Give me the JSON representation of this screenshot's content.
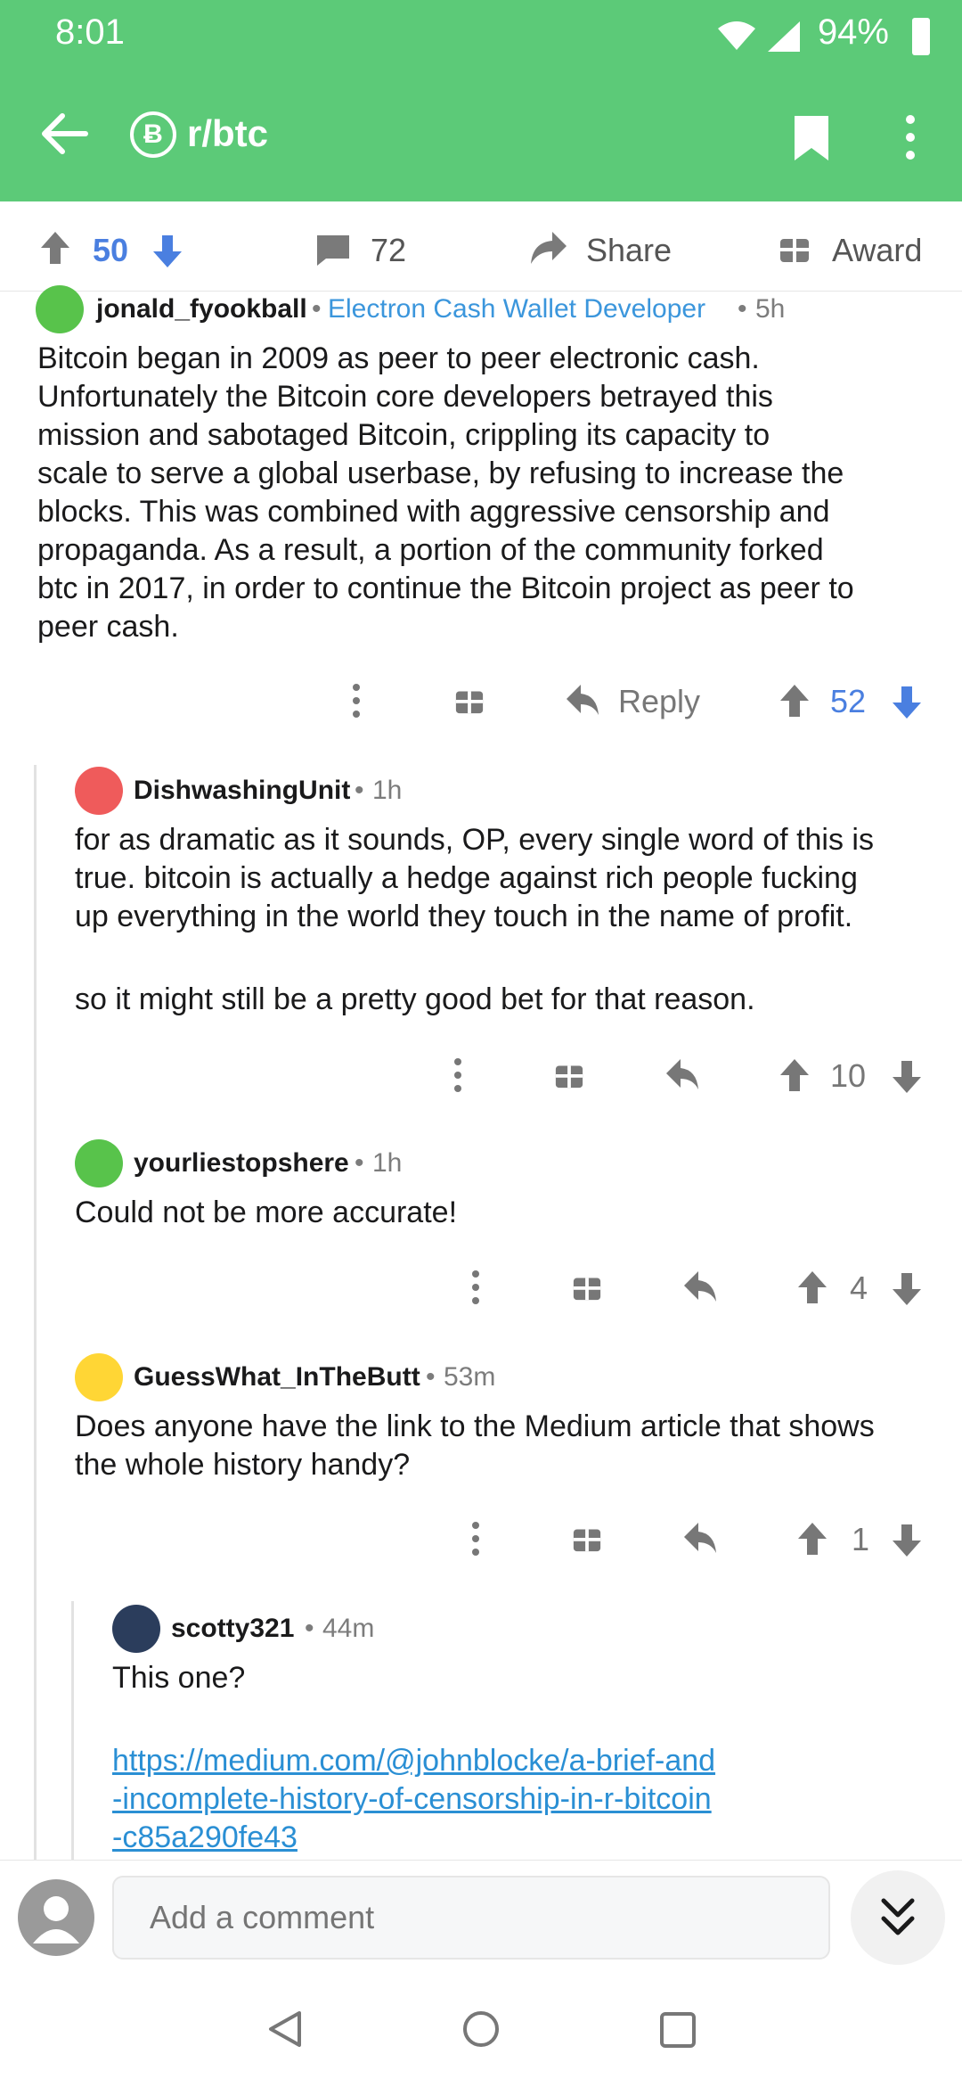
{
  "status": {
    "time": "8:01",
    "battery": "94%"
  },
  "appbar": {
    "subreddit": "r/btc",
    "badge": "Ƀ"
  },
  "post_actions": {
    "upvotes": "50",
    "comments": "72",
    "share": "Share",
    "award": "Award"
  },
  "comments": [
    {
      "user": "jonald_fyookball",
      "flair": "Electron Cash Wallet Developer",
      "age": "5h",
      "lines": [
        "Bitcoin began in 2009 as peer to peer electronic cash.",
        "Unfortunately the Bitcoin core developers betrayed this",
        "mission and sabotaged Bitcoin, crippling its capacity to",
        "scale to serve a global userbase, by refusing to increase the",
        "blocks. This was combined with aggressive censorship and",
        "propaganda.  As a result, a portion of the community forked",
        "btc in 2017, in order to continue the Bitcoin project as peer to",
        "peer cash."
      ],
      "reply": "Reply",
      "score": "52"
    },
    {
      "user": "DishwashingUnit",
      "age": "1h",
      "lines": [
        "for as dramatic as it sounds, OP, every single word of this is",
        "true. bitcoin is actually a hedge against rich people fucking",
        "up everything in the world they touch in the name of profit.",
        "",
        "so it might still be a pretty good bet for that reason."
      ],
      "score": "10"
    },
    {
      "user": "yourliestopshere",
      "age": "1h",
      "lines": [
        "Could not be more accurate!"
      ],
      "score": "4"
    },
    {
      "user": "GuessWhat_InTheButt",
      "age": "53m",
      "lines": [
        "Does anyone have the link to the Medium article that shows",
        "the whole history handy?"
      ],
      "score": "1"
    },
    {
      "user": "scotty321",
      "age": "44m",
      "lines": [
        "This one?"
      ],
      "link_lines": [
        "https://medium.com/@johnblocke/a-brief-and",
        "-incomplete-history-of-censorship-in-r-bitcoin",
        "-c85a290fe43"
      ]
    }
  ],
  "composer": {
    "placeholder": "Add a comment"
  },
  "colors": {
    "brand": "#5cca78",
    "upvote": "#4a7fe0",
    "link": "#2a8fd4"
  }
}
